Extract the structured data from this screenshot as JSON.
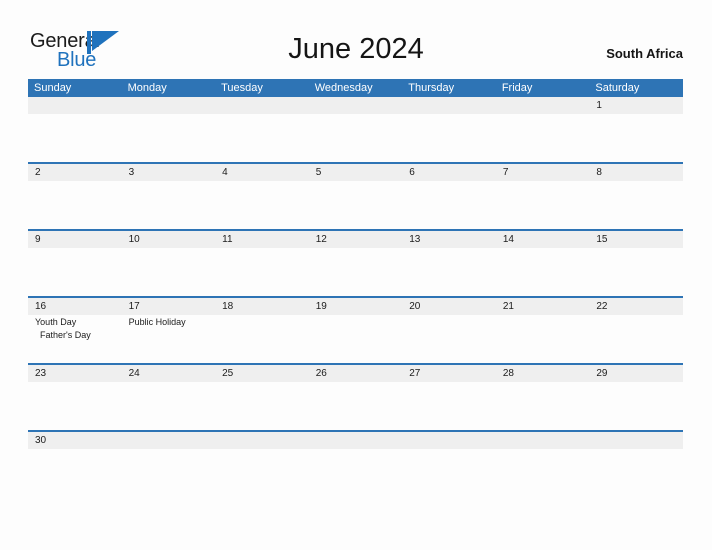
{
  "brand": {
    "word_one": "General",
    "word_two": "Blue",
    "flag_icon": "blue-flag-triangle-icon",
    "color_primary": "#1f72bd",
    "color_text": "#1b1b1b"
  },
  "header": {
    "title": "June 2024",
    "locale": "South Africa"
  },
  "theme": {
    "header_blue": "#2e74b5",
    "row_divider_blue": "#2e74b5",
    "date_band_gray": "#efefef",
    "page_background": "#fdfdfd"
  },
  "calendar": {
    "weekdays": [
      "Sunday",
      "Monday",
      "Tuesday",
      "Wednesday",
      "Thursday",
      "Friday",
      "Saturday"
    ],
    "weeks": [
      {
        "short": false,
        "days": [
          {
            "number": "",
            "events": []
          },
          {
            "number": "",
            "events": []
          },
          {
            "number": "",
            "events": []
          },
          {
            "number": "",
            "events": []
          },
          {
            "number": "",
            "events": []
          },
          {
            "number": "",
            "events": []
          },
          {
            "number": "1",
            "events": []
          }
        ]
      },
      {
        "short": false,
        "days": [
          {
            "number": "2",
            "events": []
          },
          {
            "number": "3",
            "events": []
          },
          {
            "number": "4",
            "events": []
          },
          {
            "number": "5",
            "events": []
          },
          {
            "number": "6",
            "events": []
          },
          {
            "number": "7",
            "events": []
          },
          {
            "number": "8",
            "events": []
          }
        ]
      },
      {
        "short": false,
        "days": [
          {
            "number": "9",
            "events": []
          },
          {
            "number": "10",
            "events": []
          },
          {
            "number": "11",
            "events": []
          },
          {
            "number": "12",
            "events": []
          },
          {
            "number": "13",
            "events": []
          },
          {
            "number": "14",
            "events": []
          },
          {
            "number": "15",
            "events": []
          }
        ]
      },
      {
        "short": false,
        "days": [
          {
            "number": "16",
            "events": [
              {
                "label": "Youth Day",
                "indented": false
              },
              {
                "label": "Father's Day",
                "indented": true
              }
            ]
          },
          {
            "number": "17",
            "events": [
              {
                "label": "Public Holiday",
                "indented": false
              }
            ]
          },
          {
            "number": "18",
            "events": []
          },
          {
            "number": "19",
            "events": []
          },
          {
            "number": "20",
            "events": []
          },
          {
            "number": "21",
            "events": []
          },
          {
            "number": "22",
            "events": []
          }
        ]
      },
      {
        "short": false,
        "days": [
          {
            "number": "23",
            "events": []
          },
          {
            "number": "24",
            "events": []
          },
          {
            "number": "25",
            "events": []
          },
          {
            "number": "26",
            "events": []
          },
          {
            "number": "27",
            "events": []
          },
          {
            "number": "28",
            "events": []
          },
          {
            "number": "29",
            "events": []
          }
        ]
      },
      {
        "short": true,
        "days": [
          {
            "number": "30",
            "events": []
          },
          {
            "number": "",
            "events": []
          },
          {
            "number": "",
            "events": []
          },
          {
            "number": "",
            "events": []
          },
          {
            "number": "",
            "events": []
          },
          {
            "number": "",
            "events": []
          },
          {
            "number": "",
            "events": []
          }
        ]
      }
    ]
  }
}
